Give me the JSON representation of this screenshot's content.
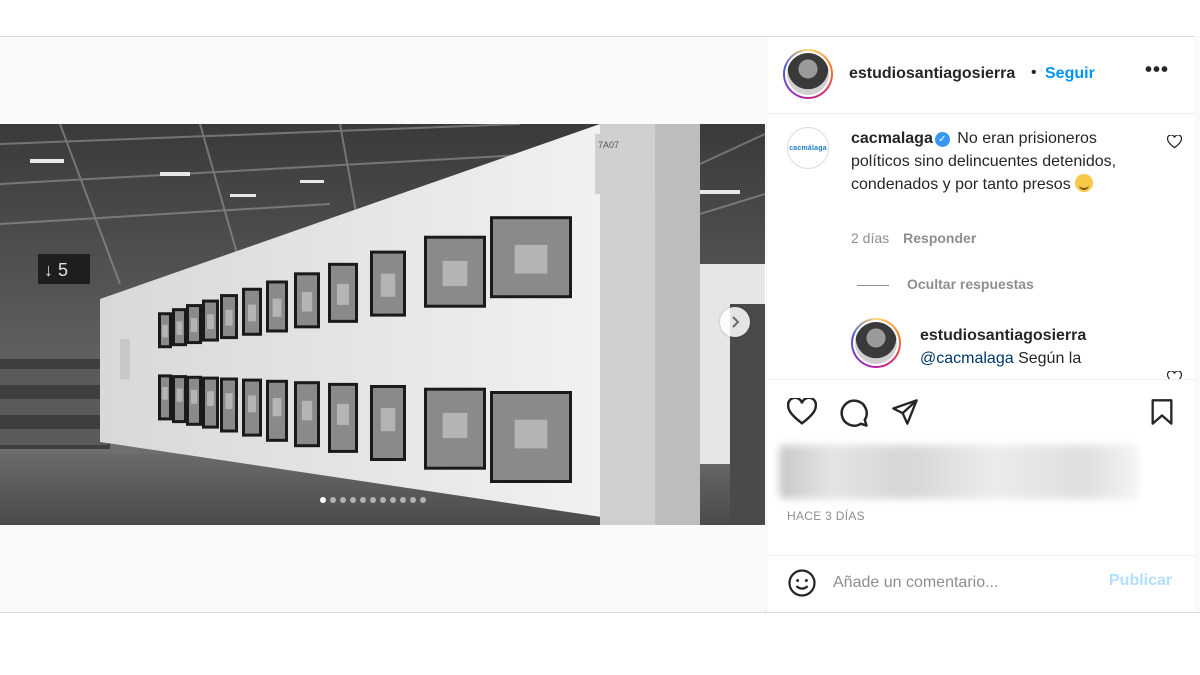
{
  "header": {
    "username": "estudiosantiagosierra",
    "separator": "•",
    "follow_label": "Seguir",
    "more_label": "•••"
  },
  "media": {
    "sign_text": "↓ 5",
    "booth_label": "7A07",
    "slide_count": 11,
    "active_slide": 1
  },
  "comment": {
    "username": "cacmalaga",
    "verified_mark": "✓",
    "avatar_logo": "cacmálaga",
    "text": "No eran prisioneros políticos sino delincuentes detenidos, condenados y por tanto presos",
    "emoji": "smiling-face-emoji",
    "time": "2 días",
    "reply_label": "Responder"
  },
  "hide_replies_label": "Ocultar respuestas",
  "reply": {
    "username": "estudiosantiagosierra",
    "mention": "@cacmalaga",
    "text": " Según la"
  },
  "date_label": "HACE 3 DÍAS",
  "add_comment": {
    "placeholder": "Añade un comentario...",
    "publish_label": "Publicar"
  },
  "colors": {
    "link_blue": "#0095f6",
    "publish_disabled": "#b2dffc",
    "mention": "#00376b",
    "muted": "#8e8e8e"
  }
}
